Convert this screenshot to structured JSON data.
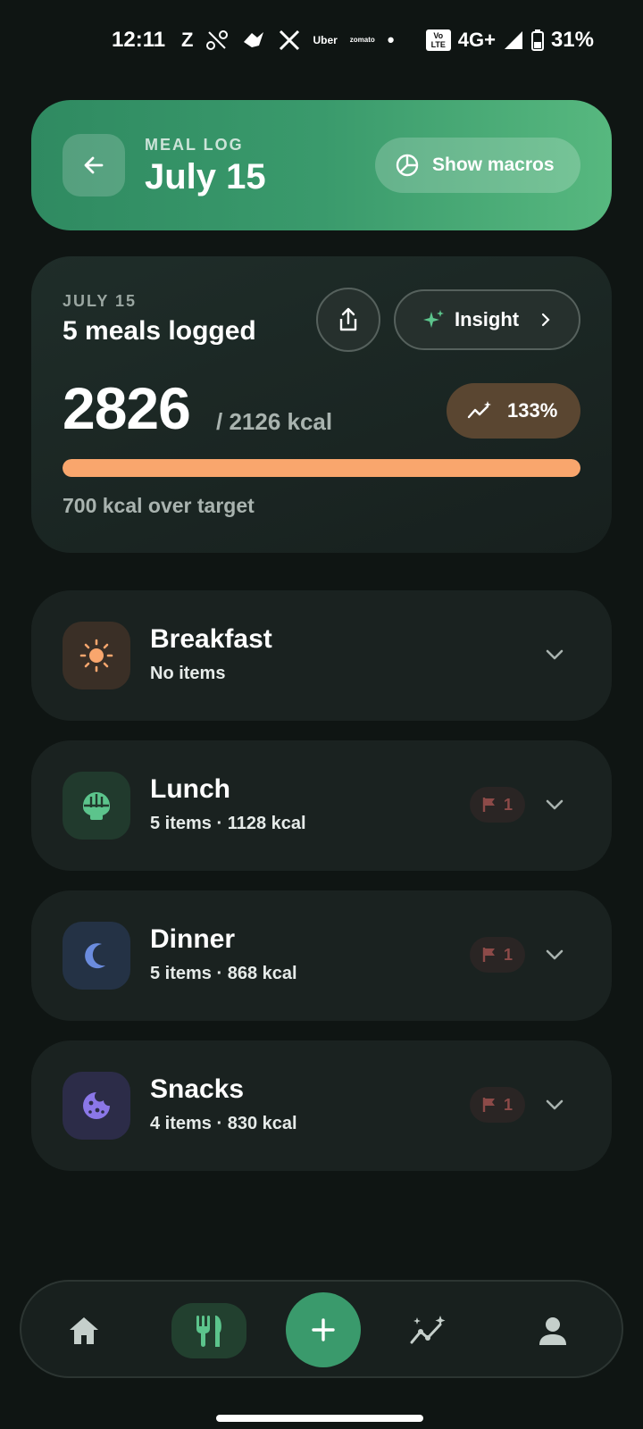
{
  "status_bar": {
    "time": "12:11",
    "notifications": [
      "Z",
      "Uber",
      "zomato",
      "•"
    ],
    "volte": "Vo LTE",
    "network": "4G+",
    "battery": "31%"
  },
  "header": {
    "kicker": "MEAL LOG",
    "title": "July 15",
    "macros_label": "Show macros"
  },
  "summary": {
    "date": "JULY 15",
    "meals_logged": "5 meals logged",
    "insight_label": "Insight",
    "kcal_consumed": "2826",
    "kcal_target": "/ 2126 kcal",
    "percent": "133%",
    "progress_fraction": 1.0,
    "over_text": "700 kcal over target"
  },
  "meals": [
    {
      "name": "Breakfast",
      "sub": "No items",
      "flag": null,
      "icon": "sun-icon"
    },
    {
      "name": "Lunch",
      "sub": "5 items · 1128 kcal",
      "flag": "1",
      "icon": "bowl-icon"
    },
    {
      "name": "Dinner",
      "sub": "5 items · 868 kcal",
      "flag": "1",
      "icon": "moon-icon"
    },
    {
      "name": "Snacks",
      "sub": "4 items · 830 kcal",
      "flag": "1",
      "icon": "cookie-icon"
    }
  ],
  "colors": {
    "accent_green": "#3a9a6c",
    "over_orange": "#f9a66d",
    "flag_red": "#8c4a48"
  },
  "nav": [
    "home-icon",
    "fork-knife-icon",
    "add-icon",
    "trends-icon",
    "profile-icon"
  ]
}
